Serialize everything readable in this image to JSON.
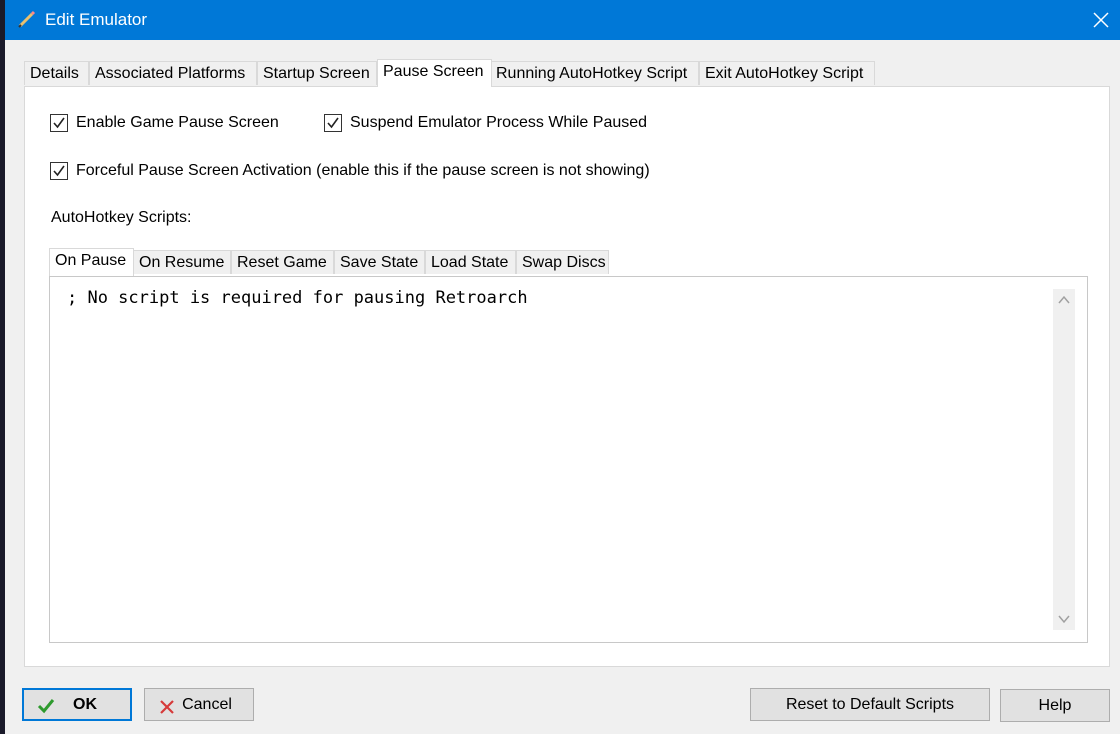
{
  "window": {
    "title": "Edit Emulator"
  },
  "main_tabs": [
    {
      "label": "Details",
      "active": false
    },
    {
      "label": "Associated Platforms",
      "active": false
    },
    {
      "label": "Startup Screen",
      "active": false
    },
    {
      "label": "Pause Screen",
      "active": true
    },
    {
      "label": "Running AutoHotkey Script",
      "active": false
    },
    {
      "label": "Exit AutoHotkey Script",
      "active": false
    }
  ],
  "pause_screen": {
    "enable_pause": {
      "label": "Enable Game Pause Screen",
      "checked": true
    },
    "suspend_process": {
      "label": "Suspend Emulator Process While Paused",
      "checked": true
    },
    "forceful_activation": {
      "label": "Forceful Pause Screen Activation (enable this if the pause screen is not showing)",
      "checked": true
    },
    "scripts_label": "AutoHotkey Scripts:",
    "script_tabs": [
      {
        "label": "On Pause",
        "active": true
      },
      {
        "label": "On Resume",
        "active": false
      },
      {
        "label": "Reset Game",
        "active": false
      },
      {
        "label": "Save State",
        "active": false
      },
      {
        "label": "Load State",
        "active": false
      },
      {
        "label": "Swap Discs",
        "active": false
      }
    ],
    "script_text": "; No script is required for pausing Retroarch"
  },
  "buttons": {
    "ok": "OK",
    "cancel": "Cancel",
    "reset_scripts": "Reset to Default Scripts",
    "help": "Help"
  },
  "colors": {
    "titlebar": "#0078d7",
    "ok_check": "#2e9a2e",
    "cancel_x": "#d63a3a"
  }
}
